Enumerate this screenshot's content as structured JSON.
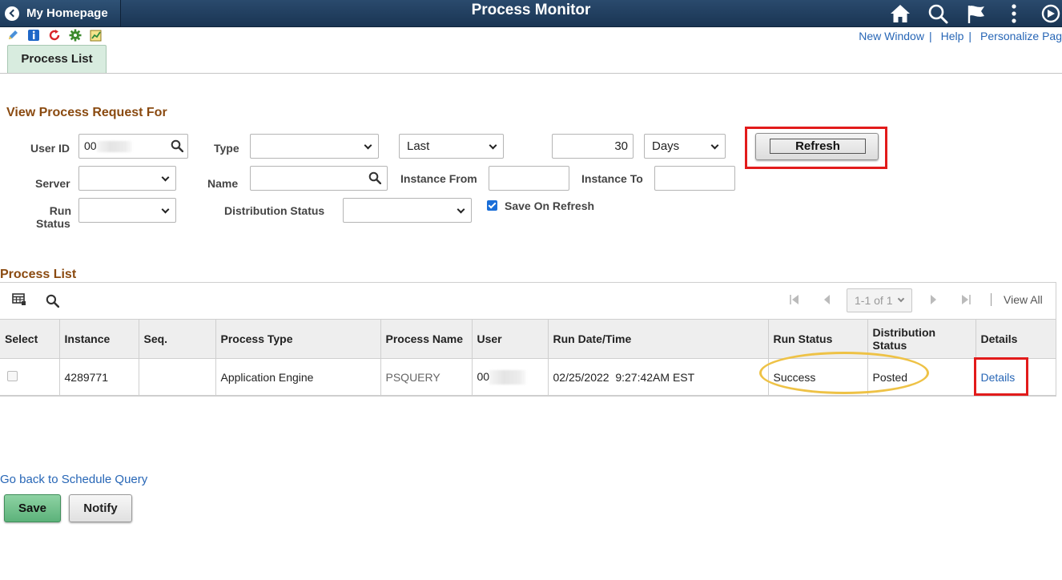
{
  "banner": {
    "home_label": "My Homepage",
    "title": "Process Monitor",
    "icons": [
      "home-icon",
      "search-icon",
      "flag-icon",
      "more-icon",
      "navbar-icon"
    ]
  },
  "toolbar_icons": [
    "edit-icon",
    "info-icon",
    "refresh-icon",
    "gear-icon",
    "chart-icon"
  ],
  "top_links": {
    "new_window": "New Window",
    "help": "Help",
    "personalize": "Personalize Pag",
    "separator": "|"
  },
  "tab": {
    "label": "Process List"
  },
  "filter": {
    "section_title": "View Process Request For",
    "user_id_label": "User ID",
    "user_id_value": "00",
    "type_label": "Type",
    "type_value": "",
    "last_value": "Last",
    "days_count": "30",
    "days_value": "Days",
    "refresh_label": "Refresh",
    "server_label": "Server",
    "server_value": "",
    "name_label": "Name",
    "name_value": "",
    "instance_from_label": "Instance From",
    "instance_from_value": "",
    "instance_to_label": "Instance To",
    "instance_to_value": "",
    "run_status_label_1": "Run",
    "run_status_label_2": "Status",
    "run_status_value": "",
    "distribution_status_label": "Distribution Status",
    "distribution_status_value": "",
    "save_on_refresh_label": "Save On Refresh",
    "save_on_refresh_checked": true
  },
  "process_list": {
    "section_title": "Process List",
    "pager": "1-1 of 1",
    "view_all": "View All",
    "columns": {
      "select": "Select",
      "instance": "Instance",
      "seq": "Seq.",
      "process_type": "Process Type",
      "process_name": "Process Name",
      "user": "User",
      "run_datetime": "Run Date/Time",
      "run_status": "Run Status",
      "distribution_status_1": "Distribution",
      "distribution_status_2": "Status",
      "details": "Details"
    },
    "rows": [
      {
        "instance": "4289771",
        "seq": "",
        "process_type": "Application Engine",
        "process_name": "PSQUERY",
        "user": "00",
        "run_datetime": "02/25/2022  9:27:42AM EST",
        "run_status": "Success",
        "distribution_status": "Posted",
        "details": "Details"
      }
    ]
  },
  "footer": {
    "back_link": "Go back to Schedule Query",
    "save_label": "Save",
    "notify_label": "Notify"
  },
  "colors": {
    "banner": "#1a3553",
    "link": "#2766b6",
    "section_title": "#8a4a10",
    "highlight_red": "#e21b1b",
    "highlight_yellow": "#eec246",
    "save_button": "#5cb27a"
  }
}
